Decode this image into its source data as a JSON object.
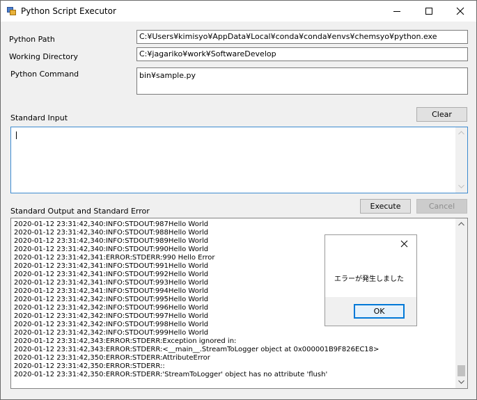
{
  "window": {
    "title": "Python Script Executor"
  },
  "form": {
    "python_path_label": "Python Path",
    "python_path_value": "C:¥Users¥kimisyo¥AppData¥Local¥conda¥conda¥envs¥chemsyo¥python.exe",
    "working_dir_label": "Working Directory",
    "working_dir_value": "C:¥jagariko¥work¥SoftwareDevelop",
    "python_command_label": "Python Command",
    "python_command_value": "bin¥sample.py",
    "stdin_label": "Standard Input",
    "clear_label": "Clear",
    "output_label": "Standard Output and Standard Error",
    "execute_label": "Execute",
    "cancel_label": "Cancel"
  },
  "log_lines": [
    "2020-01-12 23:31:42,340:INFO:STDOUT:987Hello World",
    "2020-01-12 23:31:42,340:INFO:STDOUT:988Hello World",
    "2020-01-12 23:31:42,340:INFO:STDOUT:989Hello World",
    "2020-01-12 23:31:42,340:INFO:STDOUT:990Hello World",
    "2020-01-12 23:31:42,341:ERROR:STDERR:990 Hello Error",
    "2020-01-12 23:31:42,341:INFO:STDOUT:991Hello World",
    "2020-01-12 23:31:42,341:INFO:STDOUT:992Hello World",
    "2020-01-12 23:31:42,341:INFO:STDOUT:993Hello World",
    "2020-01-12 23:31:42,341:INFO:STDOUT:994Hello World",
    "2020-01-12 23:31:42,342:INFO:STDOUT:995Hello World",
    "2020-01-12 23:31:42,342:INFO:STDOUT:996Hello World",
    "2020-01-12 23:31:42,342:INFO:STDOUT:997Hello World",
    "2020-01-12 23:31:42,342:INFO:STDOUT:998Hello World",
    "2020-01-12 23:31:42,342:INFO:STDOUT:999Hello World",
    "2020-01-12 23:31:42,343:ERROR:STDERR:Exception ignored in:",
    "2020-01-12 23:31:42,343:ERROR:STDERR:<__main__.StreamToLogger object at 0x000001B9F826EC18>",
    "2020-01-12 23:31:42,350:ERROR:STDERR:AttributeError",
    "2020-01-12 23:31:42,350:ERROR:STDERR::",
    "2020-01-12 23:31:42,350:ERROR:STDERR:'StreamToLogger' object has no attribute 'flush'"
  ],
  "dialog": {
    "message": "エラーが発生しました",
    "ok_label": "OK"
  },
  "colors": {
    "focus_border": "#3c8ad0",
    "ok_border": "#0078d7",
    "window_bg": "#f0f0f0"
  }
}
